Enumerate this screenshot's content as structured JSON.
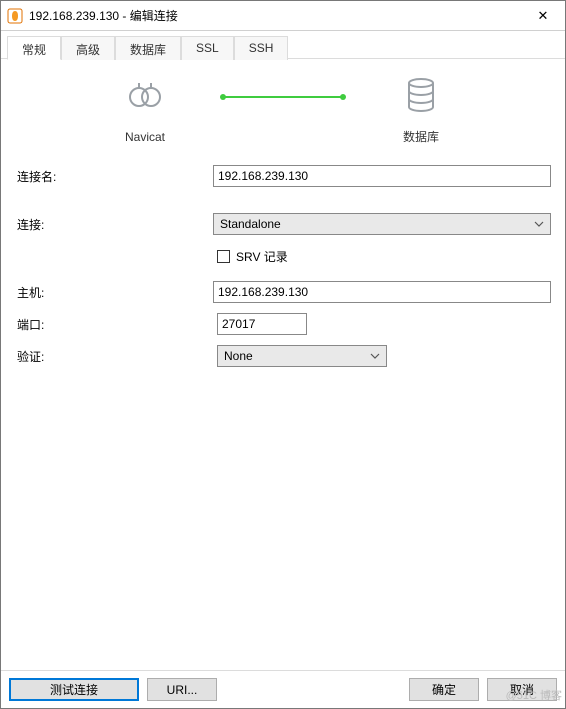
{
  "window": {
    "title": "192.168.239.130 - 编辑连接",
    "close_glyph": "✕"
  },
  "tabs": {
    "items": [
      "常规",
      "高级",
      "数据库",
      "SSL",
      "SSH"
    ],
    "active_index": 0
  },
  "diagram": {
    "left_label": "Navicat",
    "right_label": "数据库"
  },
  "form": {
    "conn_name_label": "连接名:",
    "conn_name_value": "192.168.239.130",
    "connection_label": "连接:",
    "connection_value": "Standalone",
    "srv_label": "SRV 记录",
    "srv_checked": false,
    "host_label": "主机:",
    "host_value": "192.168.239.130",
    "port_label": "端口:",
    "port_value": "27017",
    "auth_label": "验证:",
    "auth_value": "None"
  },
  "footer": {
    "test_label": "测试连接",
    "uri_label": "URI...",
    "ok_label": "确定",
    "cancel_label": "取消"
  },
  "watermark": "@51C   博客"
}
